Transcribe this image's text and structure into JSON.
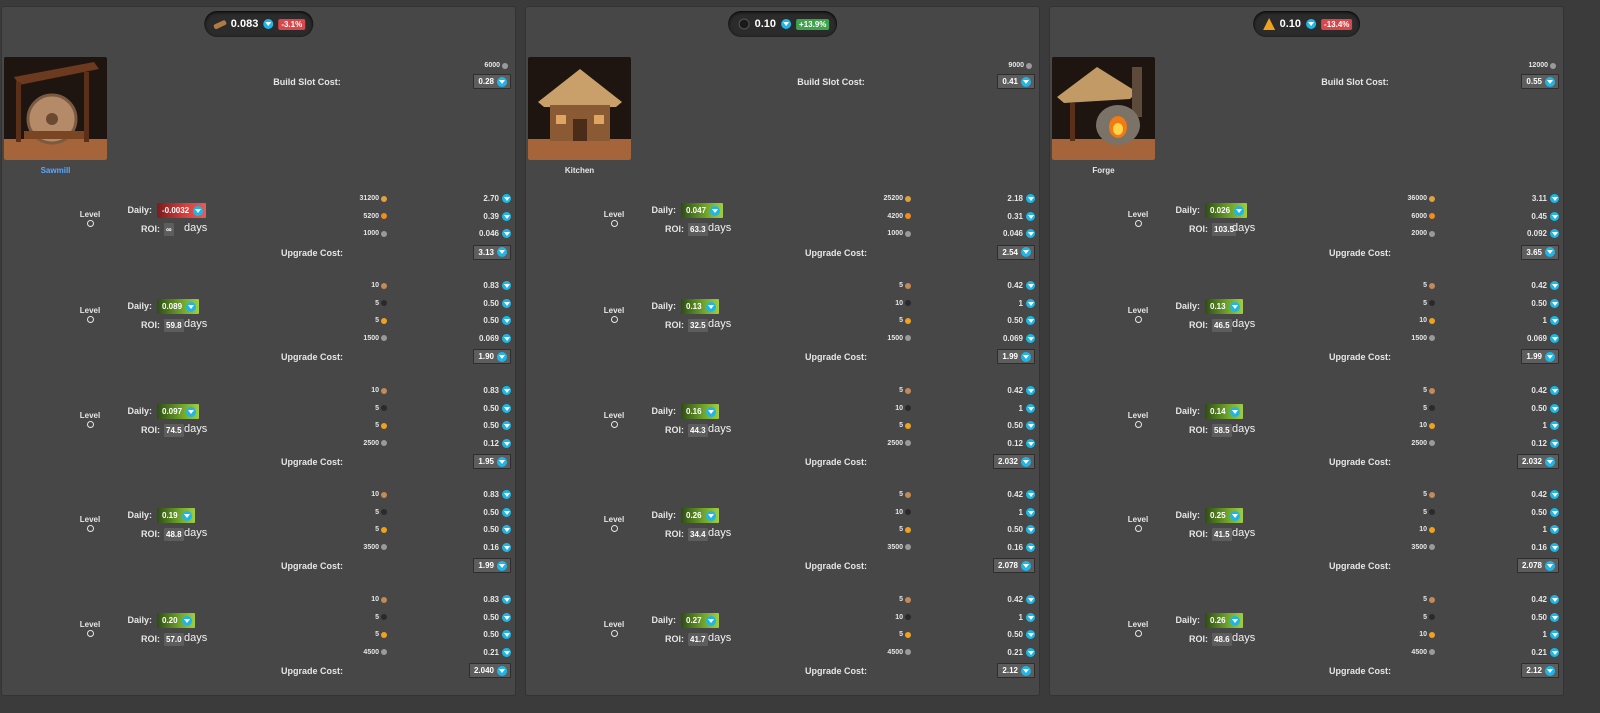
{
  "panels": [
    {
      "id": "sawmill",
      "price": "0.083",
      "change": "-3.1%",
      "change_dir": "neg",
      "resource_icon": "wood-log-icon",
      "name": "Sawmill",
      "name_is_link": true,
      "build_slot_label": "Build Slot Cost:",
      "build_slot_qty": "6000",
      "build_slot_cost": "0.28",
      "levels": [
        {
          "label": "Level",
          "daily": "-0.0032",
          "daily_dir": "neg",
          "roi": "∞",
          "roi_unit": "days",
          "rows": [
            {
              "qty": "31200",
              "icon": "gold",
              "val": "2.70"
            },
            {
              "qty": "5200",
              "icon": "amber",
              "val": "0.39"
            },
            {
              "qty": "1000",
              "icon": "stone",
              "val": "0.046"
            }
          ],
          "upgrade_label": "Upgrade Cost:",
          "upgrade": "3.13"
        },
        {
          "label": "Level",
          "daily": "0.089",
          "daily_dir": "pos",
          "roi": "59.8",
          "roi_unit": "days",
          "rows": [
            {
              "qty": "10",
              "icon": "wood",
              "val": "0.83"
            },
            {
              "qty": "5",
              "icon": "coal",
              "val": "0.50"
            },
            {
              "qty": "5",
              "icon": "fire",
              "val": "0.50"
            },
            {
              "qty": "1500",
              "icon": "stone",
              "val": "0.069"
            }
          ],
          "upgrade_label": "Upgrade Cost:",
          "upgrade": "1.90"
        },
        {
          "label": "Level",
          "daily": "0.097",
          "daily_dir": "pos",
          "roi": "74.5",
          "roi_unit": "days",
          "rows": [
            {
              "qty": "10",
              "icon": "wood",
              "val": "0.83"
            },
            {
              "qty": "5",
              "icon": "coal",
              "val": "0.50"
            },
            {
              "qty": "5",
              "icon": "fire",
              "val": "0.50"
            },
            {
              "qty": "2500",
              "icon": "stone",
              "val": "0.12"
            }
          ],
          "upgrade_label": "Upgrade Cost:",
          "upgrade": "1.95"
        },
        {
          "label": "Level",
          "daily": "0.19",
          "daily_dir": "pos",
          "roi": "48.8",
          "roi_unit": "days",
          "rows": [
            {
              "qty": "10",
              "icon": "wood",
              "val": "0.83"
            },
            {
              "qty": "5",
              "icon": "coal",
              "val": "0.50"
            },
            {
              "qty": "5",
              "icon": "fire",
              "val": "0.50"
            },
            {
              "qty": "3500",
              "icon": "stone",
              "val": "0.16"
            }
          ],
          "upgrade_label": "Upgrade Cost:",
          "upgrade": "1.99"
        },
        {
          "label": "Level",
          "daily": "0.20",
          "daily_dir": "pos",
          "roi": "57.0",
          "roi_unit": "days",
          "rows": [
            {
              "qty": "10",
              "icon": "wood",
              "val": "0.83"
            },
            {
              "qty": "5",
              "icon": "coal",
              "val": "0.50"
            },
            {
              "qty": "5",
              "icon": "fire",
              "val": "0.50"
            },
            {
              "qty": "4500",
              "icon": "stone",
              "val": "0.21"
            }
          ],
          "upgrade_label": "Upgrade Cost:",
          "upgrade": "2.040"
        }
      ]
    },
    {
      "id": "kitchen",
      "price": "0.10",
      "change": "+13.9%",
      "change_dir": "pos",
      "resource_icon": "coal-icon",
      "name": "Kitchen",
      "name_is_link": false,
      "build_slot_label": "Build Slot Cost:",
      "build_slot_qty": "9000",
      "build_slot_cost": "0.41",
      "levels": [
        {
          "label": "Level",
          "daily": "0.047",
          "daily_dir": "pos",
          "roi": "63.3",
          "roi_unit": "days",
          "rows": [
            {
              "qty": "25200",
              "icon": "gold",
              "val": "2.18"
            },
            {
              "qty": "4200",
              "icon": "amber",
              "val": "0.31"
            },
            {
              "qty": "1000",
              "icon": "stone",
              "val": "0.046"
            }
          ],
          "upgrade_label": "Upgrade Cost:",
          "upgrade": "2.54"
        },
        {
          "label": "Level",
          "daily": "0.13",
          "daily_dir": "pos",
          "roi": "32.5",
          "roi_unit": "days",
          "rows": [
            {
              "qty": "5",
              "icon": "wood",
              "val": "0.42"
            },
            {
              "qty": "10",
              "icon": "coal",
              "val": "1"
            },
            {
              "qty": "5",
              "icon": "fire",
              "val": "0.50"
            },
            {
              "qty": "1500",
              "icon": "stone",
              "val": "0.069"
            }
          ],
          "upgrade_label": "Upgrade Cost:",
          "upgrade": "1.99"
        },
        {
          "label": "Level",
          "daily": "0.16",
          "daily_dir": "pos",
          "roi": "44.3",
          "roi_unit": "days",
          "rows": [
            {
              "qty": "5",
              "icon": "wood",
              "val": "0.42"
            },
            {
              "qty": "10",
              "icon": "coal",
              "val": "1"
            },
            {
              "qty": "5",
              "icon": "fire",
              "val": "0.50"
            },
            {
              "qty": "2500",
              "icon": "stone",
              "val": "0.12"
            }
          ],
          "upgrade_label": "Upgrade Cost:",
          "upgrade": "2.032"
        },
        {
          "label": "Level",
          "daily": "0.26",
          "daily_dir": "pos",
          "roi": "34.4",
          "roi_unit": "days",
          "rows": [
            {
              "qty": "5",
              "icon": "wood",
              "val": "0.42"
            },
            {
              "qty": "10",
              "icon": "coal",
              "val": "1"
            },
            {
              "qty": "5",
              "icon": "fire",
              "val": "0.50"
            },
            {
              "qty": "3500",
              "icon": "stone",
              "val": "0.16"
            }
          ],
          "upgrade_label": "Upgrade Cost:",
          "upgrade": "2.078"
        },
        {
          "label": "Level",
          "daily": "0.27",
          "daily_dir": "pos",
          "roi": "41.7",
          "roi_unit": "days",
          "rows": [
            {
              "qty": "5",
              "icon": "wood",
              "val": "0.42"
            },
            {
              "qty": "10",
              "icon": "coal",
              "val": "1"
            },
            {
              "qty": "5",
              "icon": "fire",
              "val": "0.50"
            },
            {
              "qty": "4500",
              "icon": "stone",
              "val": "0.21"
            }
          ],
          "upgrade_label": "Upgrade Cost:",
          "upgrade": "2.12"
        }
      ]
    },
    {
      "id": "forge",
      "price": "0.10",
      "change": "-13.4%",
      "change_dir": "neg",
      "resource_icon": "fire-icon",
      "name": "Forge",
      "name_is_link": false,
      "build_slot_label": "Build Slot Cost:",
      "build_slot_qty": "12000",
      "build_slot_cost": "0.55",
      "levels": [
        {
          "label": "Level",
          "daily": "0.026",
          "daily_dir": "pos",
          "roi": "103.5",
          "roi_unit": "days",
          "rows": [
            {
              "qty": "36000",
              "icon": "gold",
              "val": "3.11"
            },
            {
              "qty": "6000",
              "icon": "amber",
              "val": "0.45"
            },
            {
              "qty": "2000",
              "icon": "stone",
              "val": "0.092"
            }
          ],
          "upgrade_label": "Upgrade Cost:",
          "upgrade": "3.65"
        },
        {
          "label": "Level",
          "daily": "0.13",
          "daily_dir": "pos",
          "roi": "46.5",
          "roi_unit": "days",
          "rows": [
            {
              "qty": "5",
              "icon": "wood",
              "val": "0.42"
            },
            {
              "qty": "5",
              "icon": "coal",
              "val": "0.50"
            },
            {
              "qty": "10",
              "icon": "fire",
              "val": "1"
            },
            {
              "qty": "1500",
              "icon": "stone",
              "val": "0.069"
            }
          ],
          "upgrade_label": "Upgrade Cost:",
          "upgrade": "1.99"
        },
        {
          "label": "Level",
          "daily": "0.14",
          "daily_dir": "pos",
          "roi": "58.5",
          "roi_unit": "days",
          "rows": [
            {
              "qty": "5",
              "icon": "wood",
              "val": "0.42"
            },
            {
              "qty": "5",
              "icon": "coal",
              "val": "0.50"
            },
            {
              "qty": "10",
              "icon": "fire",
              "val": "1"
            },
            {
              "qty": "2500",
              "icon": "stone",
              "val": "0.12"
            }
          ],
          "upgrade_label": "Upgrade Cost:",
          "upgrade": "2.032"
        },
        {
          "label": "Level",
          "daily": "0.25",
          "daily_dir": "pos",
          "roi": "41.5",
          "roi_unit": "days",
          "rows": [
            {
              "qty": "5",
              "icon": "wood",
              "val": "0.42"
            },
            {
              "qty": "5",
              "icon": "coal",
              "val": "0.50"
            },
            {
              "qty": "10",
              "icon": "fire",
              "val": "1"
            },
            {
              "qty": "3500",
              "icon": "stone",
              "val": "0.16"
            }
          ],
          "upgrade_label": "Upgrade Cost:",
          "upgrade": "2.078"
        },
        {
          "label": "Level",
          "daily": "0.26",
          "daily_dir": "pos",
          "roi": "48.6",
          "roi_unit": "days",
          "rows": [
            {
              "qty": "5",
              "icon": "wood",
              "val": "0.42"
            },
            {
              "qty": "5",
              "icon": "coal",
              "val": "0.50"
            },
            {
              "qty": "10",
              "icon": "fire",
              "val": "1"
            },
            {
              "qty": "4500",
              "icon": "stone",
              "val": "0.21"
            }
          ],
          "upgrade_label": "Upgrade Cost:",
          "upgrade": "2.12"
        }
      ]
    }
  ],
  "colors": {
    "gem": "#1fb6e6",
    "positive": "#6fa52b",
    "negative": "#d9413f",
    "link": "#5aa7ff"
  }
}
